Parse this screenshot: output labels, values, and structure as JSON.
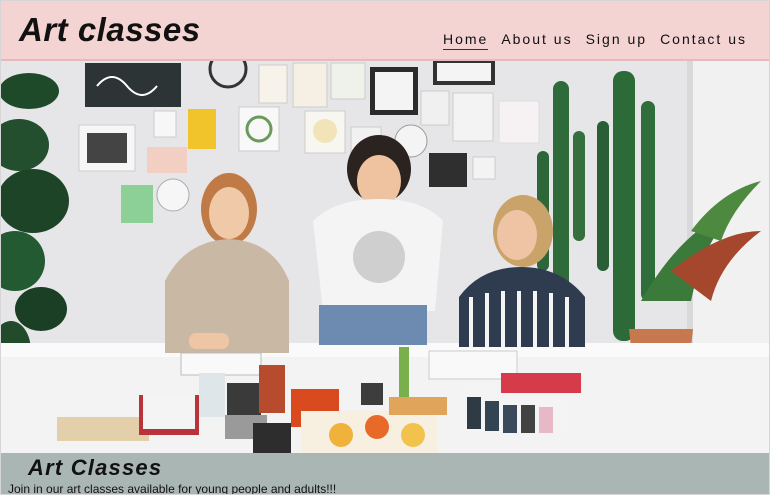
{
  "site": {
    "title": "Art classes"
  },
  "nav": {
    "items": [
      {
        "label": "Home",
        "active": true
      },
      {
        "label": "About us",
        "active": false
      },
      {
        "label": "Sign up",
        "active": false
      },
      {
        "label": "Contact us",
        "active": false
      }
    ]
  },
  "hero": {
    "image_icon": "photo-of-three-women-at-art-class-table"
  },
  "banner": {
    "title": "Art Classes",
    "text": "Join in our art classes available for young people and adults!!!"
  },
  "colors": {
    "header_bg": "#f4d3d3",
    "banner_bg": "#a9b6b4"
  }
}
